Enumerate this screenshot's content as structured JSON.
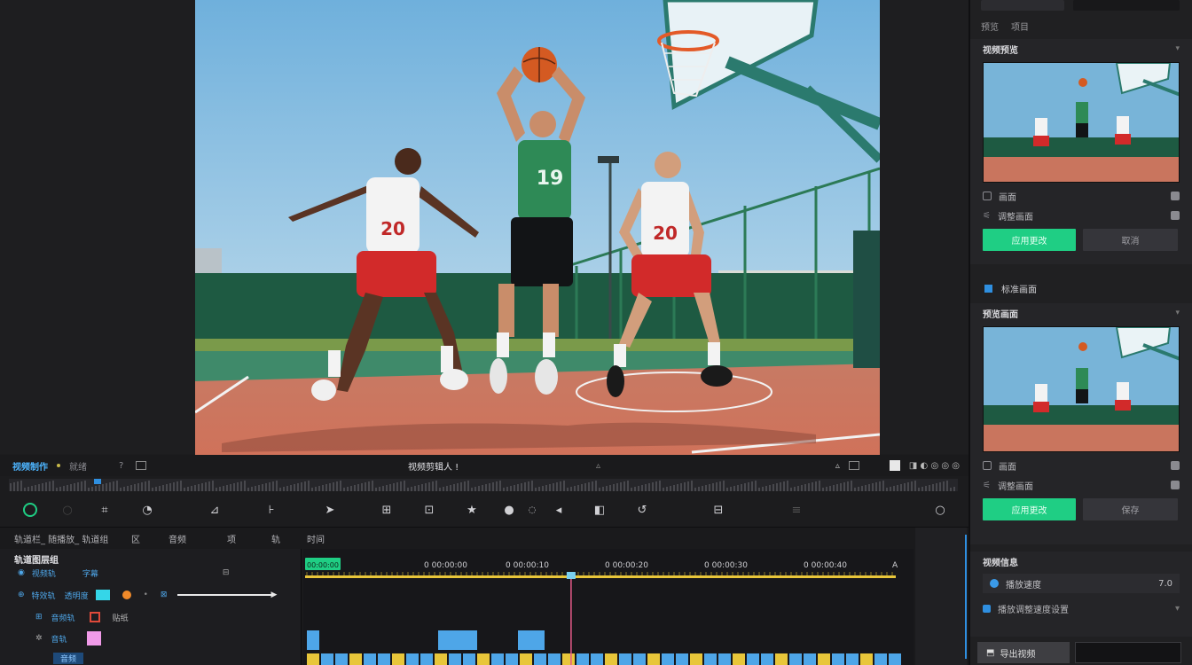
{
  "app": {
    "accent": "#1fce84",
    "link_color": "#4db5ff",
    "background": "#1c1c1e"
  },
  "transport": {
    "project_name": "视频制作",
    "status_text": "就绪",
    "sep_text": "?",
    "center_title": "视频剪辑人 !",
    "center_mark": "▵",
    "right_labels": [
      "▵",
      "◼",
      "◨ ◐ ◎ ◎ ◎"
    ]
  },
  "tools": {
    "icons": [
      "record-icon",
      "disabled-icon",
      "crop-icon",
      "loop-icon",
      "tilde-icon",
      "split-icon",
      "arrow-icon",
      "speaker-icon",
      "add-icon",
      "star-icon",
      "circle-icon",
      "fish-icon",
      "flag-icon",
      "undo-icon",
      "export-icon",
      "menu-icon",
      "search-icon"
    ]
  },
  "timeline": {
    "header_labels": [
      "轨道栏_ 随播放_ 轨道组",
      "区",
      "音频",
      "项",
      "轨",
      "时间"
    ],
    "track_title": "轨道图层组",
    "tracks": [
      {
        "label1": "视频轨",
        "label2": "字幕"
      },
      {
        "label1": "特效轨",
        "label2": "透明度",
        "arrow_label": "——"
      },
      {
        "label1": "音频轨",
        "label2": "贴纸"
      },
      {
        "label1": "音轨",
        "label2": ""
      },
      {
        "label1": "音频",
        "label2": ""
      }
    ],
    "marker_label": "00:00:00",
    "timecodes": [
      "0 00:00:00",
      "0 00:00:10",
      "0 00:00:20",
      "0 00:00:30",
      "0 00:00:40",
      "A"
    ],
    "playhead_progress": 0.45
  },
  "right_panel": {
    "top_tabs": [
      "预览",
      "项目"
    ],
    "section1": {
      "title": "视频预览",
      "row1": "画面",
      "row2": "调整画面",
      "btn_primary": "应用更改",
      "btn_secondary": "取消"
    },
    "checkbox_label": "标准画面",
    "section2": {
      "title": "预览画面",
      "row1": "画面",
      "row2": "调整画面",
      "btn_primary": "应用更改",
      "btn_secondary": "保存"
    },
    "section3": {
      "title": "视频信息",
      "input_label": "播放速度",
      "input_value": "7.0",
      "row_label": "播放调整速度设置"
    },
    "bottom_button": "导出视频"
  }
}
